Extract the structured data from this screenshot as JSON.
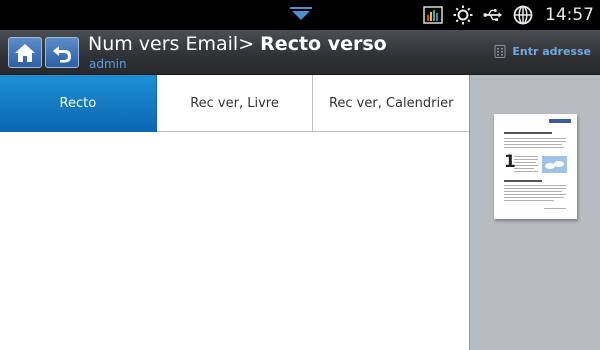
{
  "statusbar": {
    "time": "14:57",
    "icons": [
      "signal-bars-icon",
      "brightness-icon",
      "usb-icon",
      "globe-icon"
    ]
  },
  "header": {
    "title_prefix": "Num vers Email> ",
    "title_bold": "Recto verso",
    "user": "admin",
    "address_button": "Entr adresse"
  },
  "tabs": [
    {
      "label": "Recto",
      "active": true
    },
    {
      "label": "Rec ver, Livre",
      "active": false
    },
    {
      "label": "Rec ver, Calendrier",
      "active": false
    }
  ],
  "preview": {
    "page_number": "1"
  },
  "colors": {
    "accent": "#0b67b2",
    "link": "#5aa0e6",
    "titlebar": "#2f3134",
    "preview_bg": "#b7bcc2"
  }
}
